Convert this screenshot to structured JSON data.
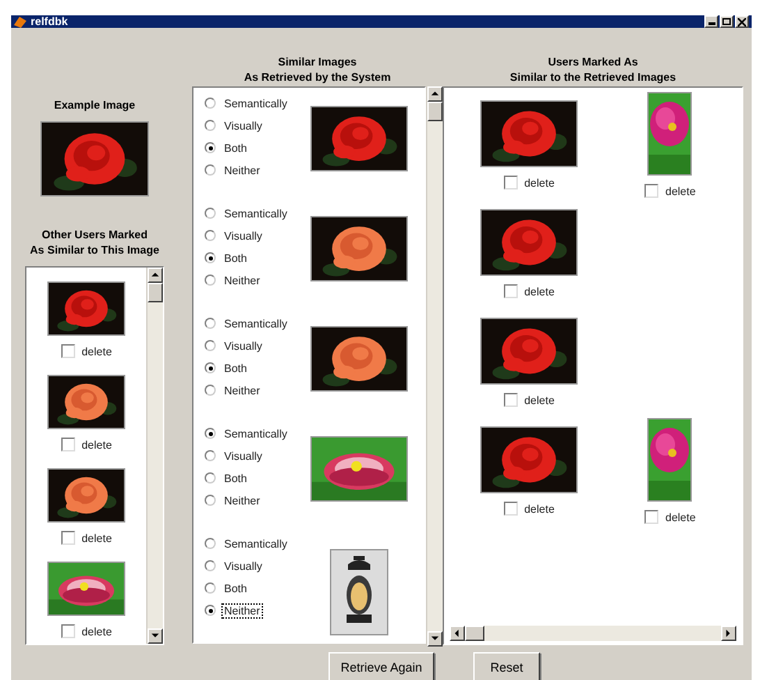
{
  "window": {
    "title": "relfdbk"
  },
  "example": {
    "label": "Example Image"
  },
  "other_users": {
    "heading": [
      "Other Users Marked",
      "As Similar to This Image"
    ],
    "items": [
      {
        "kind": "picture",
        "label": "delete",
        "checked": false
      },
      {
        "kind": "picture",
        "label": "delete",
        "checked": false
      },
      {
        "kind": "picture",
        "label": "delete",
        "checked": false
      },
      {
        "kind": "picture",
        "label": "delete",
        "checked": false
      }
    ]
  },
  "retrieved": {
    "heading": [
      "Similar Images",
      "As Retrieved by the System"
    ],
    "groups": [
      {
        "options": [
          {
            "label": "Semantically",
            "selected": false,
            "focused": false
          },
          {
            "label": "Visually",
            "selected": false,
            "focused": false
          },
          {
            "label": "Both",
            "selected": true,
            "focused": false
          },
          {
            "label": "Neither",
            "selected": false,
            "focused": false
          }
        ]
      },
      {
        "options": [
          {
            "label": "Semantically",
            "selected": false,
            "focused": false
          },
          {
            "label": "Visually",
            "selected": false,
            "focused": false
          },
          {
            "label": "Both",
            "selected": true,
            "focused": false
          },
          {
            "label": "Neither",
            "selected": false,
            "focused": false
          }
        ]
      },
      {
        "options": [
          {
            "label": "Semantically",
            "selected": false,
            "focused": false
          },
          {
            "label": "Visually",
            "selected": false,
            "focused": false
          },
          {
            "label": "Both",
            "selected": true,
            "focused": false
          },
          {
            "label": "Neither",
            "selected": false,
            "focused": false
          }
        ]
      },
      {
        "options": [
          {
            "label": "Semantically",
            "selected": true,
            "focused": false
          },
          {
            "label": "Visually",
            "selected": false,
            "focused": false
          },
          {
            "label": "Both",
            "selected": false,
            "focused": false
          },
          {
            "label": "Neither",
            "selected": false,
            "focused": false
          }
        ]
      },
      {
        "options": [
          {
            "label": "Semantically",
            "selected": false,
            "focused": false
          },
          {
            "label": "Visually",
            "selected": false,
            "focused": false
          },
          {
            "label": "Both",
            "selected": false,
            "focused": false
          },
          {
            "label": "Neither",
            "selected": true,
            "focused": true
          }
        ]
      }
    ]
  },
  "users_marked": {
    "heading": [
      "Users Marked As",
      "Similar to the Retrieved Images"
    ],
    "rows": [
      {
        "items": [
          {
            "kind": "picture",
            "label": "delete",
            "checked": false
          },
          {
            "kind": "picture",
            "label": "delete",
            "checked": false
          }
        ]
      },
      {
        "items": [
          {
            "kind": "picture",
            "label": "delete",
            "checked": false
          }
        ]
      },
      {
        "items": [
          {
            "kind": "picture",
            "label": "delete",
            "checked": false
          }
        ]
      },
      {
        "items": [
          {
            "kind": "picture",
            "label": "delete",
            "checked": false
          },
          {
            "kind": "picture",
            "label": "delete",
            "checked": false
          }
        ]
      }
    ]
  },
  "buttons": [
    "Retrieve Again",
    "Reset"
  ]
}
